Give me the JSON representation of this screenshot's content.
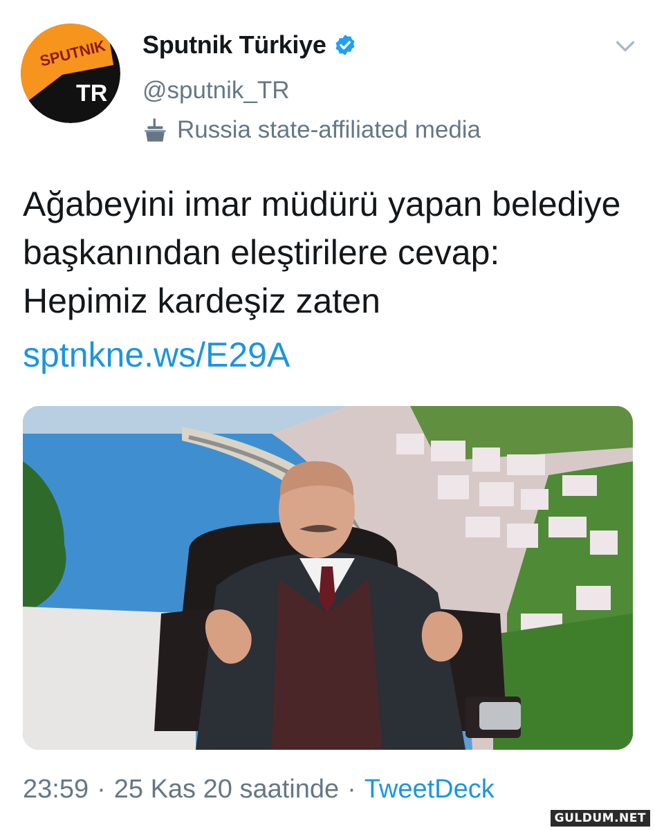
{
  "account": {
    "display_name": "Sputnik Türkiye",
    "handle": "@sputnik_TR",
    "label": "Russia state-affiliated media",
    "avatar": {
      "brand_text": "SPUTNIK",
      "region_text": "TR",
      "colors": {
        "orange": "#f7941d",
        "black": "#111111",
        "brand_text": "#8a1c1c",
        "region_text": "#ffffff"
      }
    },
    "verified": true
  },
  "tweet": {
    "text": "Ağabeyini imar müdürü yapan belediye başkanından eleştirilere cevap: Hepimiz kardeşiz zaten",
    "link": "sptnkne.ws/E29A",
    "media": {
      "kind": "photo",
      "content": "man-in-suit-seated-in-leather-chair-in-front-of-coastal-city-mural"
    },
    "time": "23:59",
    "separator1": "·",
    "date": "25 Kas 20 saatinde",
    "separator2": "·",
    "source": "TweetDeck"
  },
  "watermark": "GULDUM.NET",
  "icons": {
    "verified": "verified-badge-icon",
    "affiliation": "podium-icon",
    "menu": "chevron-down-icon"
  },
  "colors": {
    "link": "#1b95e0",
    "secondary_text": "#657786",
    "primary_text": "#14171a",
    "verified": "#1da1f2"
  }
}
